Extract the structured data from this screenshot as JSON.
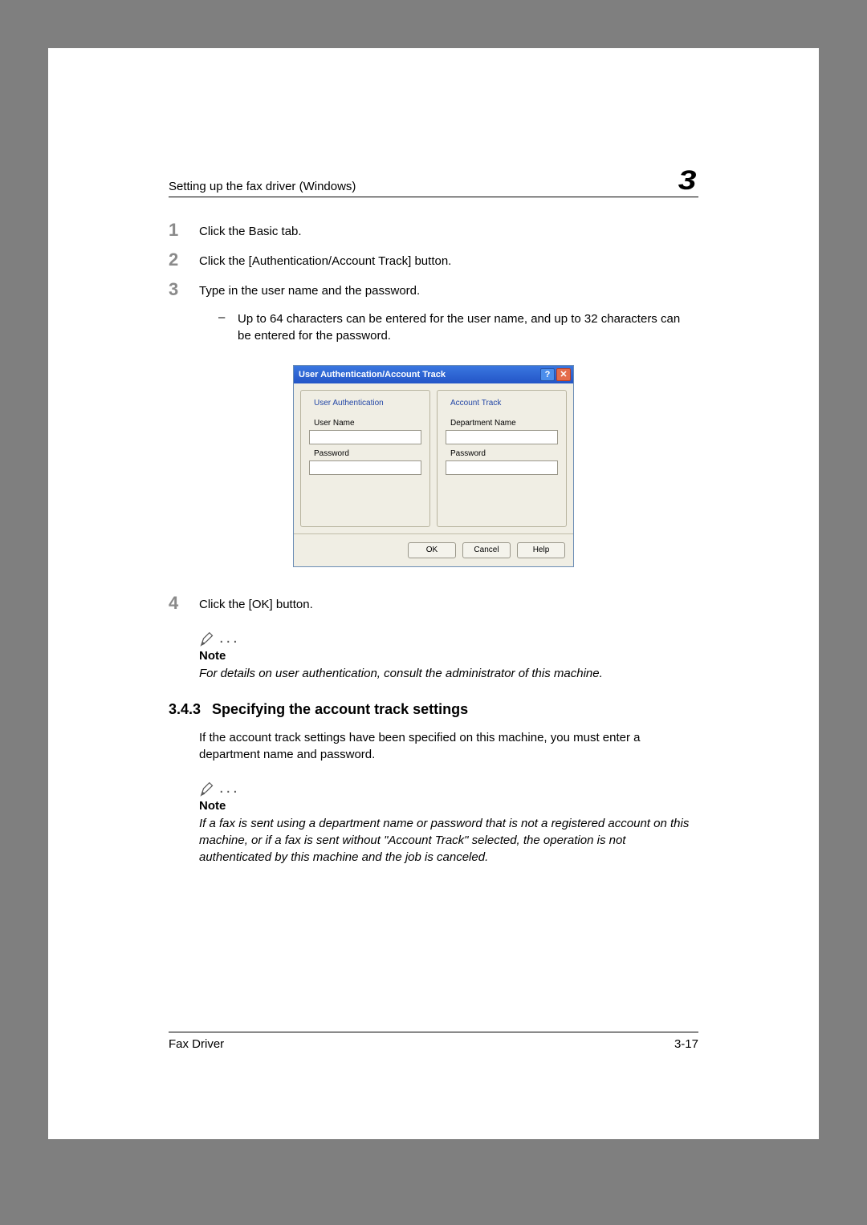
{
  "header": {
    "title": "Setting up the fax driver (Windows)",
    "chapter_number": "3"
  },
  "steps": [
    {
      "num": "1",
      "text": "Click the Basic tab."
    },
    {
      "num": "2",
      "text": "Click the [Authentication/Account Track] button."
    },
    {
      "num": "3",
      "text": "Type in the user name and the password."
    },
    {
      "num": "4",
      "text": "Click the [OK] button."
    }
  ],
  "sub_bullet": {
    "dash": "–",
    "text": "Up to 64 characters can be entered for the user name, and up to 32 characters can be entered for the password."
  },
  "dialog": {
    "title": "User Authentication/Account Track",
    "help_sym": "?",
    "close_sym": "✕",
    "left": {
      "legend": "User Authentication",
      "label1": "User Name",
      "label2": "Password"
    },
    "right": {
      "legend": "Account Track",
      "label1": "Department Name",
      "label2": "Password"
    },
    "buttons": {
      "ok": "OK",
      "cancel": "Cancel",
      "help": "Help"
    }
  },
  "note1": {
    "label": "Note",
    "body": "For details on user authentication, consult the administrator of this machine."
  },
  "section": {
    "num": "3.4.3",
    "title": "Specifying the account track settings",
    "body": "If the account track settings have been specified on this machine, you must enter a department name and password."
  },
  "note2": {
    "label": "Note",
    "body": "If a fax is sent using a department name or password that is not a registered account on this machine, or if a fax is sent without \"Account Track\" selected, the operation is not authenticated by this machine and the job is canceled."
  },
  "footer": {
    "left": "Fax Driver",
    "right": "3-17"
  }
}
